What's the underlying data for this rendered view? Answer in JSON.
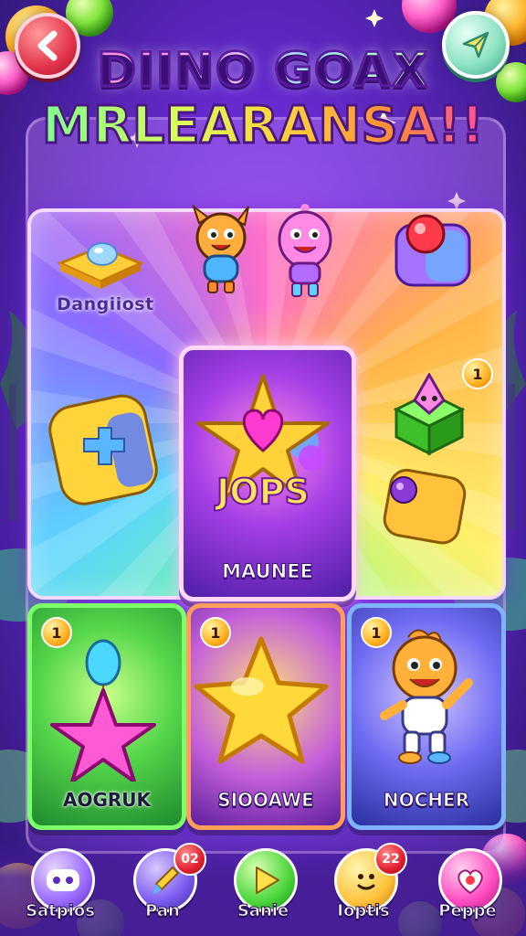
{
  "header": {
    "back_icon": "chevron-left-icon",
    "share_icon": "paper-plane-icon",
    "title_line1": "DIINO GOAX",
    "title_line2": "MRLEARANSA!!"
  },
  "board": {
    "gem_label": "Dangiiost",
    "center_card": {
      "name": "MAUNEE",
      "art_text": "JOPS"
    },
    "corner_badge": "1"
  },
  "cards": [
    {
      "name": "AOGRUK",
      "badge": "1",
      "color": "green"
    },
    {
      "name": "SIOOAWE",
      "badge": "1",
      "color": "gold"
    },
    {
      "name": "NOCHER",
      "badge": "1",
      "color": "blue"
    }
  ],
  "nav": [
    {
      "label": "Satpios",
      "icon": "gamepad-icon"
    },
    {
      "label": "Pan",
      "icon": "brush-icon",
      "badge": "02"
    },
    {
      "label": "Sanie",
      "icon": "play-icon"
    },
    {
      "label": "Ioptis",
      "icon": "smiley-icon",
      "badge": "22"
    },
    {
      "label": "Peppe",
      "icon": "heart-icon"
    }
  ],
  "colors": {
    "accent_pink": "#ff6ad5",
    "accent_green": "#7dff6a",
    "accent_blue": "#7fb3ff",
    "badge_red": "#e0202e"
  }
}
